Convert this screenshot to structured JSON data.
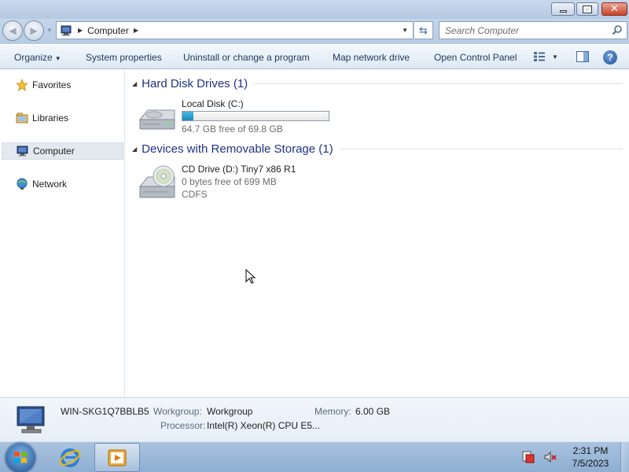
{
  "window": {
    "controls": {
      "minimize": "minimize",
      "maximize": "maximize",
      "close": "close"
    }
  },
  "navbar": {
    "address": {
      "crumbs": [
        "Computer"
      ]
    },
    "search": {
      "placeholder": "Search Computer",
      "value": ""
    }
  },
  "toolbar": {
    "organize_label": "Organize",
    "system_properties_label": "System properties",
    "uninstall_label": "Uninstall or change a program",
    "map_drive_label": "Map network drive",
    "control_panel_label": "Open Control Panel"
  },
  "sidebar": {
    "items": [
      {
        "label": "Favorites",
        "icon": "star-icon",
        "selected": false
      },
      {
        "label": "Libraries",
        "icon": "libraries-icon",
        "selected": false
      },
      {
        "label": "Computer",
        "icon": "computer-icon",
        "selected": true
      },
      {
        "label": "Network",
        "icon": "network-icon",
        "selected": false
      }
    ]
  },
  "groups": {
    "hard_disks": {
      "title": "Hard Disk Drives (1)",
      "drives": [
        {
          "name": "Local Disk (C:)",
          "free_text": "64.7 GB free of 69.8 GB",
          "used_fraction": 0.073,
          "icon": "hard-disk-icon"
        }
      ]
    },
    "removable": {
      "title": "Devices with Removable Storage (1)",
      "drives": [
        {
          "name": "CD Drive (D:) Tiny7 x86 R1",
          "free_text": "0 bytes free of 699 MB",
          "filesystem": "CDFS",
          "icon": "cd-drive-icon"
        }
      ]
    }
  },
  "details": {
    "computer_name": "WIN-SKG1Q7BBLB5",
    "workgroup_label": "Workgroup:",
    "workgroup_value": "Workgroup",
    "memory_label": "Memory:",
    "memory_value": "6.00 GB",
    "processor_label": "Processor:",
    "processor_value": "Intel(R) Xeon(R) CPU E5..."
  },
  "taskbar": {
    "clock_time": "2:31 PM",
    "clock_date": "7/5/2023"
  },
  "colors": {
    "group_title": "#1e3287",
    "capacity_fill": "#1a8ac0",
    "taskbar": "#8eaed2"
  }
}
